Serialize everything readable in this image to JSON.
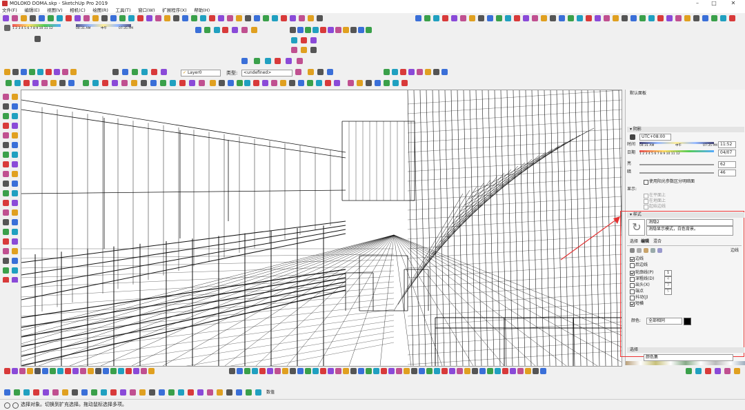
{
  "window": {
    "title": "MOLOKO DOMA.skp - SketchUp Pro 2019",
    "min": "–",
    "max": "□",
    "close": "✕"
  },
  "menu": [
    "文件(F)",
    "编辑(E)",
    "视图(V)",
    "相机(C)",
    "绘图(R)",
    "工具(T)",
    "窗口(W)",
    "扩展程序(X)",
    "帮助(H)"
  ],
  "shadow_toolbar": {
    "ruler_numbers": "1 2 3 4 5 6 7 8 9 10 11 12",
    "time_start": "04:31 AM",
    "noon": "中午",
    "time_end": "07:35 PM"
  },
  "layers_toolbar": {
    "layer_value": "Layer0",
    "type_label": "类型:",
    "type_value": "<undefined>"
  },
  "tray": {
    "default_panel_title": "默认面板",
    "shadows": {
      "title": "阴影",
      "utc": "UTC+08:00",
      "time_label": "时间",
      "time_start": "04:31 AM",
      "time_noon": "中午",
      "time_end": "07:35 PM",
      "time_value": "11:52",
      "date_label": "日期",
      "date_months": "1 2 3 4 5 6 7 8 9 10 11 12",
      "date_value": "04/07",
      "light_label": "亮",
      "light_value": "62",
      "dark_label": "暗",
      "dark_value": "46",
      "sun_checkbox": "使用阳光参数区分明暗面",
      "display_label": "显示:",
      "on_faces": "在平面上",
      "on_ground": "在地面上",
      "from_edges": "起始边线"
    },
    "styles": {
      "title": "样式",
      "style_name": "消隐2",
      "style_desc": "消隐显示模式，白色背景。",
      "tab_select": "选择",
      "tab_edit": "编辑",
      "tab_mix": "混合",
      "edges_label": "边线",
      "opt_edges": "边线",
      "opt_back_edges": "后边线",
      "opt_profiles": "轮廓线(P)",
      "opt_profiles_val": "1",
      "opt_depth_cue": "深粗线(D)",
      "opt_depth_cue_val": "4",
      "opt_extension": "出头(X)",
      "opt_extension_val": "3",
      "opt_endpoints": "端点",
      "opt_endpoints_val": "5",
      "opt_jitter": "抖动(J)",
      "opt_halo": "短横",
      "color_label": "颜色:",
      "color_value": "全部相同"
    },
    "materials": {
      "title": "选择",
      "dropdown": "颜色集"
    }
  },
  "status": {
    "message": "选择对象。切换到扩充选择。拖动鼠标选择多项。",
    "measure_label": "数值"
  },
  "colors": {
    "accent": "#e33333",
    "viewport_bg": "#ffffff",
    "tray_bg": "#f5f5f5"
  }
}
